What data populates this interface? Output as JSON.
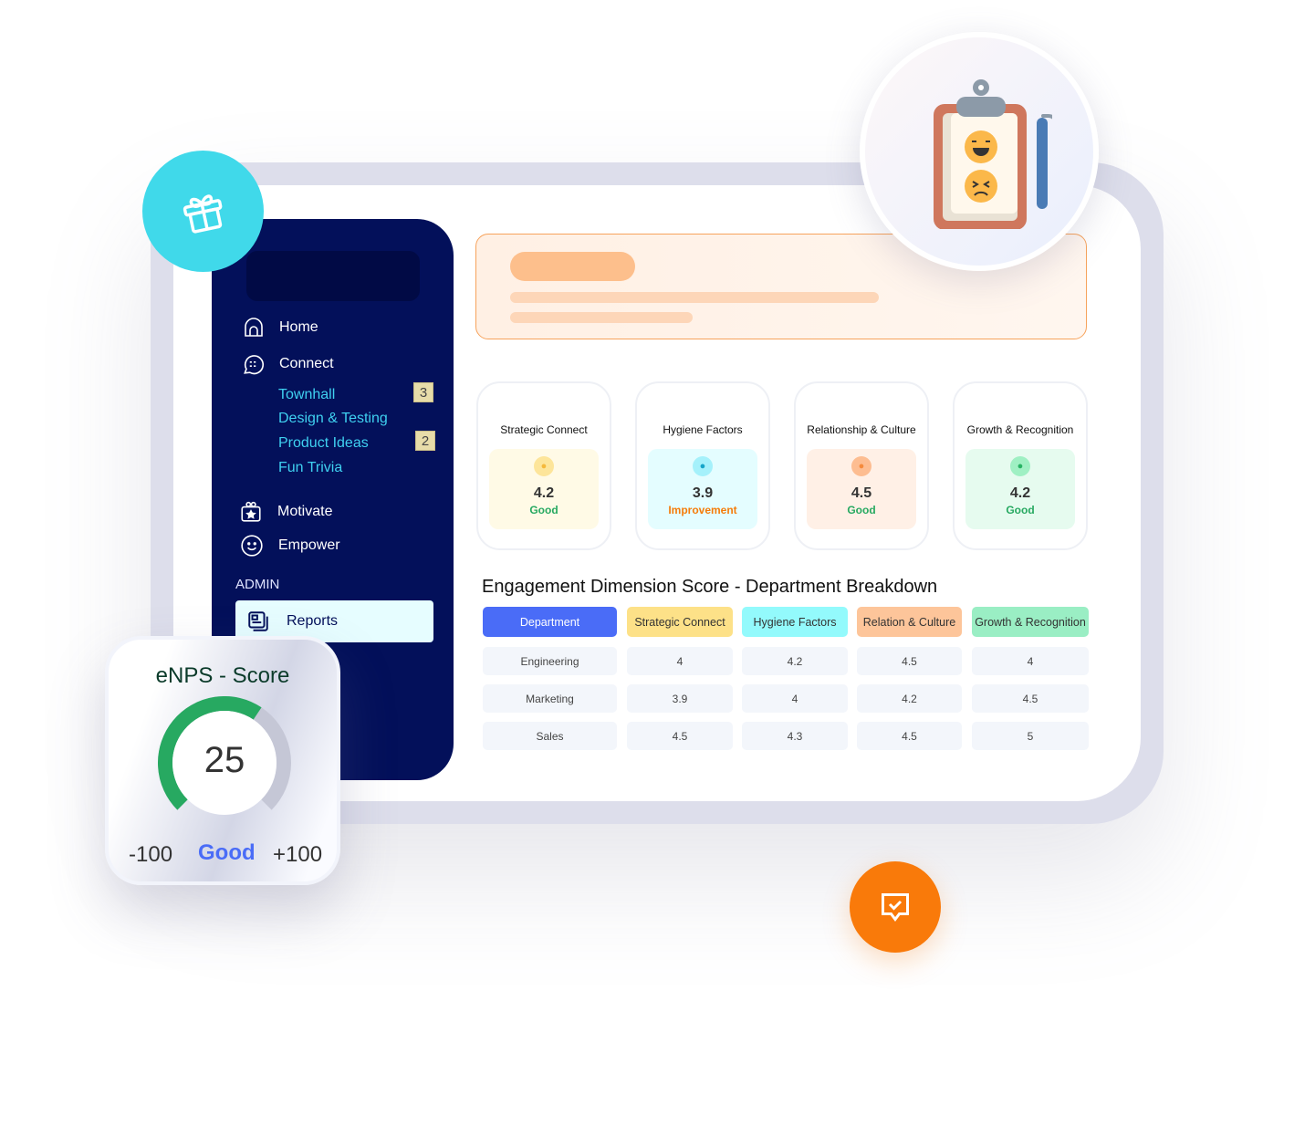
{
  "sidebar": {
    "items": [
      {
        "label": "Home",
        "icon": "home-icon"
      },
      {
        "label": "Connect",
        "icon": "chat-icon"
      }
    ],
    "sub_items": [
      {
        "label": "Townhall",
        "badge": "3"
      },
      {
        "label": "Design & Testing",
        "badge": ""
      },
      {
        "label": "Product Ideas",
        "badge": "2"
      },
      {
        "label": "Fun Trivia",
        "badge": ""
      }
    ],
    "items2": [
      {
        "label": "Motivate",
        "icon": "gift-box-icon"
      },
      {
        "label": "Empower",
        "icon": "smile-icon"
      }
    ],
    "admin_label": "ADMIN",
    "reports_label": "Reports"
  },
  "cards": [
    {
      "title": "Strategic Connect",
      "value": "4.2",
      "status": "Good",
      "bg": "#fffae6",
      "icon_bg": "#fde59a",
      "icon_color": "#f5b93b",
      "status_color": "#27a961"
    },
    {
      "title": "Hygiene Factors",
      "value": "3.9",
      "status": "Improvement",
      "bg": "#e4fdff",
      "icon_bg": "#a5f1fb",
      "icon_color": "#16a5c9",
      "status_color": "#f57c0a"
    },
    {
      "title": "Relationship & Culture",
      "value": "4.5",
      "status": "Good",
      "bg": "#fff0e6",
      "icon_bg": "#fdbd91",
      "icon_color": "#f58a3c",
      "status_color": "#27a961"
    },
    {
      "title": "Growth & Recognition",
      "value": "4.2",
      "status": "Good",
      "bg": "#e6fbef",
      "icon_bg": "#9ff0c3",
      "icon_color": "#28b464",
      "status_color": "#27a961"
    }
  ],
  "table": {
    "title": "Engagement Dimension Score - Department Breakdown",
    "headers": [
      {
        "label": "Department",
        "color": "#4a6cf7"
      },
      {
        "label": "Strategic Connect",
        "color": "#fde188"
      },
      {
        "label": "Hygiene Factors",
        "color": "#93fafc"
      },
      {
        "label": "Relation & Culture",
        "color": "#fdc59a"
      },
      {
        "label": "Growth & Recognition",
        "color": "#9aeec4"
      }
    ],
    "rows": [
      [
        "Engineering",
        "4",
        "4.2",
        "4.5",
        "4"
      ],
      [
        "Marketing",
        "3.9",
        "4",
        "4.2",
        "4.5"
      ],
      [
        "Sales",
        "4.5",
        "4.3",
        "4.5",
        "5"
      ]
    ]
  },
  "enps": {
    "title": "eNPS - Score",
    "value": "25",
    "score": 25,
    "min": "-100",
    "max": "+100",
    "status": "Good",
    "gauge_color": "#27a961"
  }
}
